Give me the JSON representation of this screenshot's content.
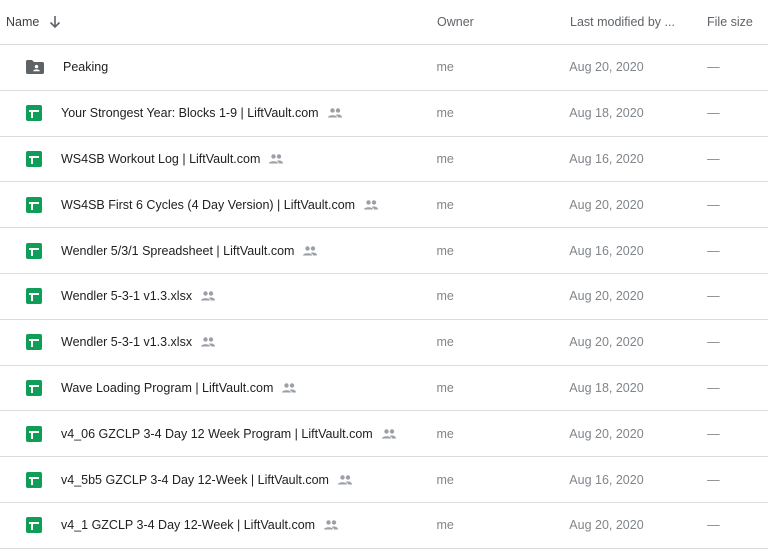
{
  "header": {
    "name": "Name",
    "owner": "Owner",
    "last_modified": "Last modified by ...",
    "file_size": "File size",
    "sort_icon": "arrow-down-icon"
  },
  "colors": {
    "sheets_green": "#0f9d58",
    "folder_gray": "#5f6368",
    "divider": "#dadce0"
  },
  "rows": [
    {
      "name": "Peaking",
      "owner": "me",
      "modified": "Aug 20, 2020",
      "size": "—",
      "icon": "folder-shared-icon",
      "shared": false
    },
    {
      "name": "Your Strongest Year: Blocks 1-9 | LiftVault.com",
      "owner": "me",
      "modified": "Aug 18, 2020",
      "size": "—",
      "icon": "google-sheets-icon",
      "shared": true
    },
    {
      "name": "WS4SB Workout Log | LiftVault.com",
      "owner": "me",
      "modified": "Aug 16, 2020",
      "size": "—",
      "icon": "google-sheets-icon",
      "shared": true
    },
    {
      "name": "WS4SB First 6 Cycles (4 Day Version) | LiftVault.com",
      "owner": "me",
      "modified": "Aug 20, 2020",
      "size": "—",
      "icon": "google-sheets-icon",
      "shared": true
    },
    {
      "name": "Wendler 5/3/1 Spreadsheet | LiftVault.com",
      "owner": "me",
      "modified": "Aug 16, 2020",
      "size": "—",
      "icon": "google-sheets-icon",
      "shared": true
    },
    {
      "name": "Wendler 5-3-1 v1.3.xlsx",
      "owner": "me",
      "modified": "Aug 20, 2020",
      "size": "—",
      "icon": "google-sheets-icon",
      "shared": true
    },
    {
      "name": "Wendler 5-3-1 v1.3.xlsx",
      "owner": "me",
      "modified": "Aug 20, 2020",
      "size": "—",
      "icon": "google-sheets-icon",
      "shared": true
    },
    {
      "name": "Wave Loading Program | LiftVault.com",
      "owner": "me",
      "modified": "Aug 18, 2020",
      "size": "—",
      "icon": "google-sheets-icon",
      "shared": true
    },
    {
      "name": "v4_06 GZCLP 3-4 Day 12 Week Program | LiftVault.com",
      "owner": "me",
      "modified": "Aug 20, 2020",
      "size": "—",
      "icon": "google-sheets-icon",
      "shared": true
    },
    {
      "name": "v4_5b5 GZCLP 3-4 Day 12-Week | LiftVault.com",
      "owner": "me",
      "modified": "Aug 16, 2020",
      "size": "—",
      "icon": "google-sheets-icon",
      "shared": true
    },
    {
      "name": "v4_1 GZCLP 3-4 Day 12-Week | LiftVault.com",
      "owner": "me",
      "modified": "Aug 20, 2020",
      "size": "—",
      "icon": "google-sheets-icon",
      "shared": true
    }
  ]
}
